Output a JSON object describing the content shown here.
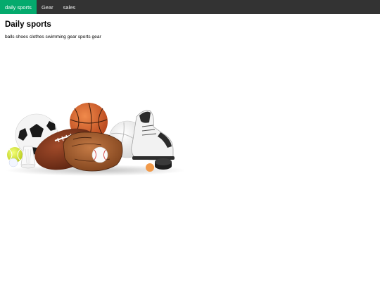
{
  "nav": {
    "items": [
      {
        "label": "daily sports",
        "active": true
      },
      {
        "label": "Gear",
        "active": false
      },
      {
        "label": "sales",
        "active": false
      }
    ],
    "active_color": "#04AA6D",
    "bar_color": "#333333"
  },
  "main": {
    "title": "Daily sports",
    "description": "balls shoes clothes swimming gear sports gear"
  },
  "hero_image": {
    "icon": "sports-equipment-photo"
  }
}
